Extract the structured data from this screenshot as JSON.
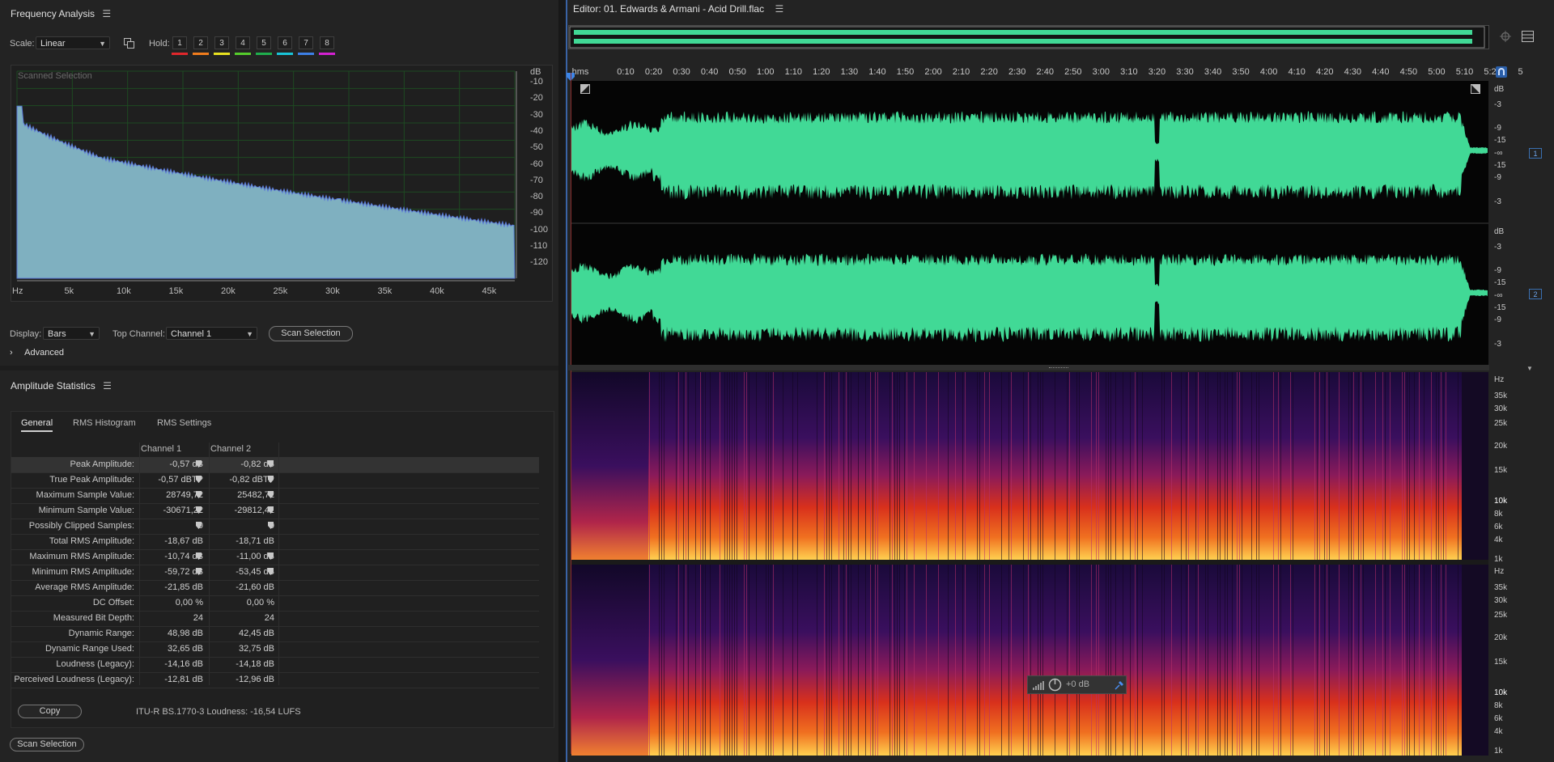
{
  "freq": {
    "title": "Frequency Analysis",
    "scale_label": "Scale:",
    "scale_value": "Linear",
    "hold_label": "Hold:",
    "hold_buttons": [
      "1",
      "2",
      "3",
      "4",
      "5",
      "6",
      "7",
      "8"
    ],
    "hold_colors": [
      "#e0272c",
      "#f07c1d",
      "#e8e220",
      "#55cc2c",
      "#1fae4d",
      "#19c4d8",
      "#3d7fe6",
      "#d321d1"
    ],
    "plot_caption": "Scanned Selection",
    "db_unit": "dB",
    "db_ticks": [
      "-10",
      "-20",
      "-30",
      "-40",
      "-50",
      "-60",
      "-70",
      "-80",
      "-90",
      "-100",
      "-110",
      "-120"
    ],
    "hz_ticks": [
      "Hz",
      "5k",
      "10k",
      "15k",
      "20k",
      "25k",
      "30k",
      "35k",
      "40k",
      "45k"
    ],
    "display_label": "Display:",
    "display_value": "Bars",
    "top_channel_label": "Top Channel:",
    "top_channel_value": "Channel 1",
    "scan_button": "Scan Selection",
    "advanced_label": "Advanced"
  },
  "amp": {
    "title": "Amplitude Statistics",
    "tabs": [
      "General",
      "RMS Histogram",
      "RMS Settings"
    ],
    "col1": "Channel 1",
    "col2": "Channel 2",
    "rows": [
      {
        "label": "Peak Amplitude:",
        "v1": "-0,57 dB",
        "v2": "-0,82 dB"
      },
      {
        "label": "True Peak Amplitude:",
        "v1": "-0,57 dBTP",
        "v2": "-0,82 dBTP"
      },
      {
        "label": "Maximum Sample Value:",
        "v1": "28749,72",
        "v2": "25482,72"
      },
      {
        "label": "Minimum Sample Value:",
        "v1": "-30671,22",
        "v2": "-29812,41"
      },
      {
        "label": "Possibly Clipped Samples:",
        "v1": "0",
        "v2": "0"
      },
      {
        "label": "Total RMS Amplitude:",
        "v1": "-18,67 dB",
        "v2": "-18,71 dB"
      },
      {
        "label": "Maximum RMS Amplitude:",
        "v1": "-10,74 dB",
        "v2": "-11,00 dB"
      },
      {
        "label": "Minimum RMS Amplitude:",
        "v1": "-59,72 dB",
        "v2": "-53,45 dB"
      },
      {
        "label": "Average RMS Amplitude:",
        "v1": "-21,85 dB",
        "v2": "-21,60 dB"
      },
      {
        "label": "DC Offset:",
        "v1": "0,00 %",
        "v2": "0,00 %"
      },
      {
        "label": "Measured Bit Depth:",
        "v1": "24",
        "v2": "24"
      },
      {
        "label": "Dynamic Range:",
        "v1": "48,98 dB",
        "v2": "42,45 dB"
      },
      {
        "label": "Dynamic Range Used:",
        "v1": "32,65 dB",
        "v2": "32,75 dB"
      },
      {
        "label": "Loudness (Legacy):",
        "v1": "-14,16 dB",
        "v2": "-14,18 dB"
      },
      {
        "label": "Perceived Loudness (Legacy):",
        "v1": "-12,81 dB",
        "v2": "-12,96 dB"
      }
    ],
    "copy_button": "Copy",
    "loudness_text": "ITU-R BS.1770-3 Loudness: -16,54 LUFS",
    "scan_button": "Scan Selection"
  },
  "editor": {
    "title": "Editor: 01. Edwards & Armani - Acid Drill.flac",
    "time_labels": [
      "hms",
      "0:10",
      "0:20",
      "0:30",
      "0:40",
      "0:50",
      "1:00",
      "1:10",
      "1:20",
      "1:30",
      "1:40",
      "1:50",
      "2:00",
      "2:10",
      "2:20",
      "2:30",
      "2:40",
      "2:50",
      "3:00",
      "3:10",
      "3:20",
      "3:30",
      "3:40",
      "3:50",
      "4:00",
      "4:10",
      "4:20",
      "4:30",
      "4:40",
      "4:50",
      "5:00",
      "5:10",
      "5:20",
      "5"
    ],
    "db_labels": [
      "dB",
      "-3",
      "-9",
      "-15",
      "-∞",
      "-15",
      "-9",
      "-3"
    ],
    "hz_labels": [
      "Hz",
      "35k",
      "30k",
      "25k",
      "20k",
      "15k",
      "10k",
      "8k",
      "6k",
      "4k",
      "1k"
    ],
    "channel_badges": [
      "1",
      "2"
    ],
    "hud_gain": "+0 dB"
  }
}
